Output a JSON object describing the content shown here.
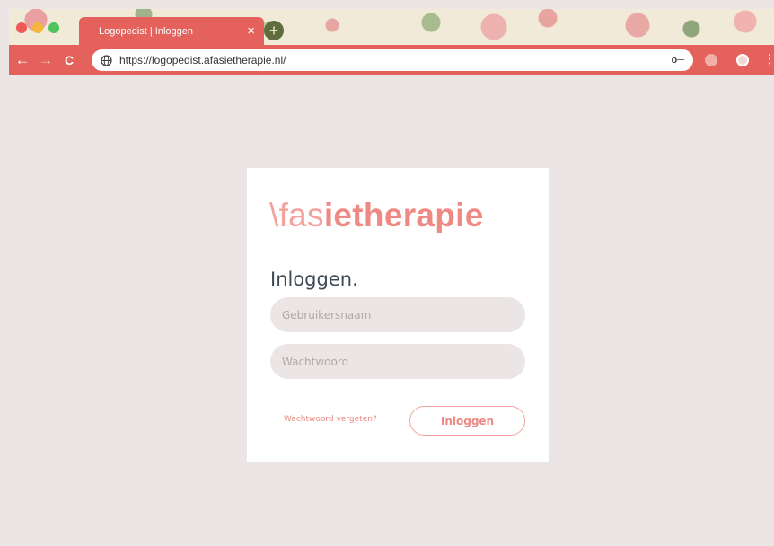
{
  "browser": {
    "tab_title": "Logopedist | Inloggen",
    "tab_close": "×",
    "new_tab": "+",
    "url": "https://logopedist.afasietherapie.nl/",
    "nav": {
      "back": "←",
      "forward": "→",
      "reload": "C"
    },
    "key_glyph": "o─",
    "menu_glyph": "⋮"
  },
  "login": {
    "logo_light": "\\fas",
    "logo_bold": "ietherapie",
    "heading": "Inloggen.",
    "username_placeholder": "Gebruikersnaam",
    "password_placeholder": "Wachtwoord",
    "forgot_link": "Wachtwoord vergeten?",
    "submit_label": "Inloggen"
  },
  "colors": {
    "accent": "#ee8a83",
    "chrome": "#e4625b",
    "field_bg": "#ece5e5",
    "page_bg": "#ece5e5"
  }
}
